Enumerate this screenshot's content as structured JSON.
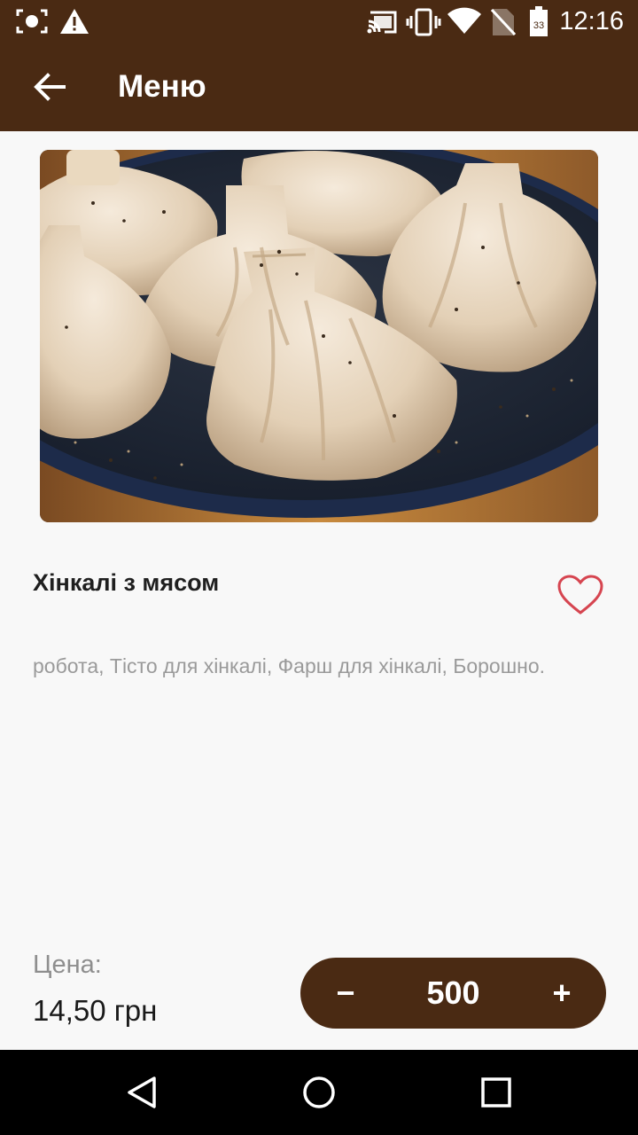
{
  "status_bar": {
    "time": "12:16",
    "battery_level": "33",
    "icons": [
      "screenshot-icon",
      "warning-icon",
      "cast-icon",
      "vibrate-icon",
      "wifi-icon",
      "no-sim-icon",
      "battery-icon"
    ]
  },
  "app_bar": {
    "title": "Меню",
    "back_icon": "arrow-left-icon"
  },
  "product": {
    "title": "Хінкалі з мясом",
    "ingredients": "робота, Тісто для хінкалі, Фарш для хінкалі, Борошно.",
    "favorite_icon": "heart-outline-icon",
    "image": "khinkali-photo"
  },
  "price": {
    "label": "Цена:",
    "value": "14,50 грн"
  },
  "quantity": {
    "minus": "−",
    "value": "500",
    "plus": "+"
  },
  "nav_bar": {
    "icons": [
      "back-triangle-icon",
      "home-circle-icon",
      "recents-square-icon"
    ]
  },
  "colors": {
    "brand": "#4a2a13",
    "background": "#f8f8f8",
    "heart": "#d64550",
    "muted_text": "#9a9a9a"
  }
}
